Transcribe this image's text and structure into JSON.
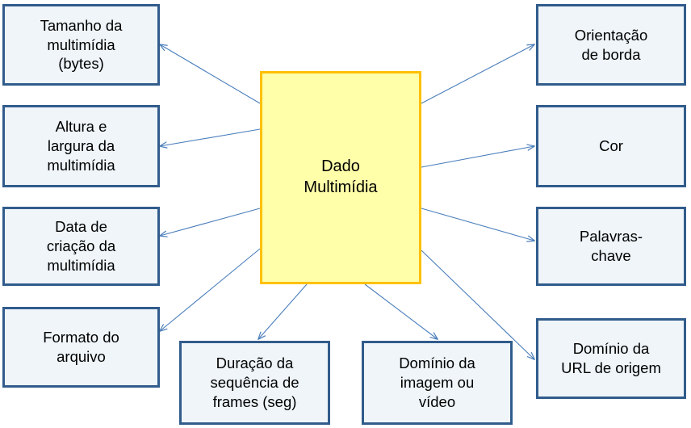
{
  "diagram": {
    "title": "Dado Multimídia",
    "colors": {
      "leaf_fill": "#eff5f9",
      "leaf_border": "#315c8c",
      "center_fill": "#ffffaa",
      "center_border": "#ffc000",
      "arrow": "#4a7ebb",
      "background": "#ffffff"
    },
    "center": {
      "label": "Dado\nMultimídia"
    },
    "nodes": [
      {
        "id": "tamanho",
        "label": "Tamanho da\nmultimídia\n(bytes)",
        "side": "left"
      },
      {
        "id": "dimensoes",
        "label": "Altura e\nlargura da\nmultimídia",
        "side": "left"
      },
      {
        "id": "data",
        "label": "Data de\ncriação da\nmultimídia",
        "side": "left"
      },
      {
        "id": "formato",
        "label": "Formato do\narquivo",
        "side": "left"
      },
      {
        "id": "duracao",
        "label": "Duração da\nsequência de\nframes (seg)",
        "side": "bottom"
      },
      {
        "id": "dominio-imagem",
        "label": "Domínio da\nimagem ou\nvídeo",
        "side": "bottom"
      },
      {
        "id": "orientacao",
        "label": "Orientação\nde borda",
        "side": "right"
      },
      {
        "id": "cor",
        "label": "Cor",
        "side": "right"
      },
      {
        "id": "palavras",
        "label": "Palavras-\nchave",
        "side": "right"
      },
      {
        "id": "dominio-url",
        "label": "Domínio da\nURL de origem",
        "side": "right"
      }
    ]
  }
}
